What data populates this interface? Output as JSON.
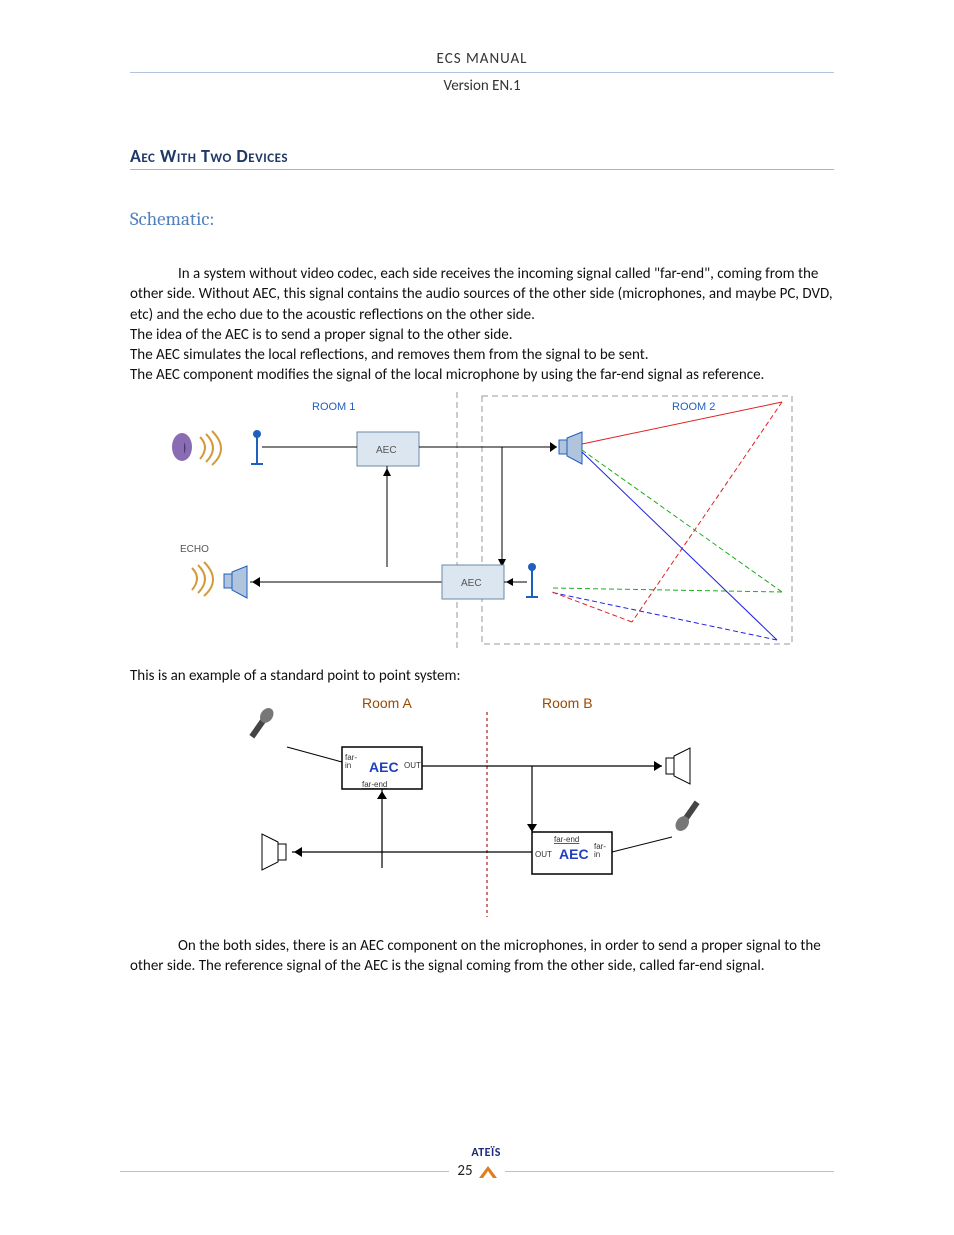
{
  "header": {
    "title": "ECS  MANUAL",
    "version": "Version EN.1"
  },
  "section": {
    "heading": "Aec With Two Devices",
    "subheading": "Schematic:"
  },
  "para": {
    "p1": "In a system without video codec, each side receives the incoming signal called \"far-end\", coming from the other side. Without AEC, this signal contains the audio sources of the other side (microphones, and maybe PC, DVD, etc) and the echo due to the acoustic reflections on the other side.",
    "p2": "The idea of the AEC is to send a proper signal to the other side.",
    "p3": "The AEC simulates the local reflections, and removes them from the signal to be sent.",
    "p4": "The AEC component modifies the signal of the local microphone by using the far-end signal as reference.",
    "caption2": "This is an example of a standard point to point system:",
    "p5": "On the both sides, there is an AEC component on the microphones, in order to send a proper signal to the other side. The reference signal of the AEC is the signal coming from the other side, called far-end signal."
  },
  "fig1": {
    "room1": "ROOM 1",
    "room2": "ROOM 2",
    "aec": "AEC",
    "echo": "ECHO"
  },
  "fig2": {
    "roomA": "Room A",
    "roomB": "Room B",
    "aec": "AEC",
    "farin": "far-\nin",
    "farend": "far-end",
    "out": "OUT"
  },
  "footer": {
    "page": "25",
    "brand": "ATEÏS"
  }
}
